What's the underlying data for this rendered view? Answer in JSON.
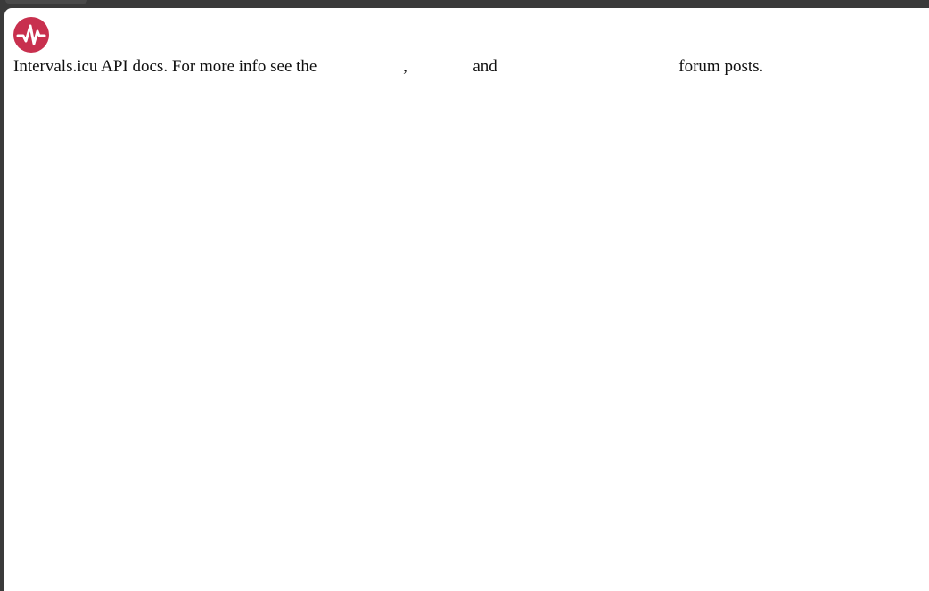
{
  "app": {
    "logo_icon": "heartbeat-pulse-icon",
    "brand_color": "#c8304e"
  },
  "intro": {
    "text_1": "Intervals.icu API docs. For more info see the",
    "text_2": ",",
    "text_3": "and",
    "text_4": "forum posts."
  }
}
